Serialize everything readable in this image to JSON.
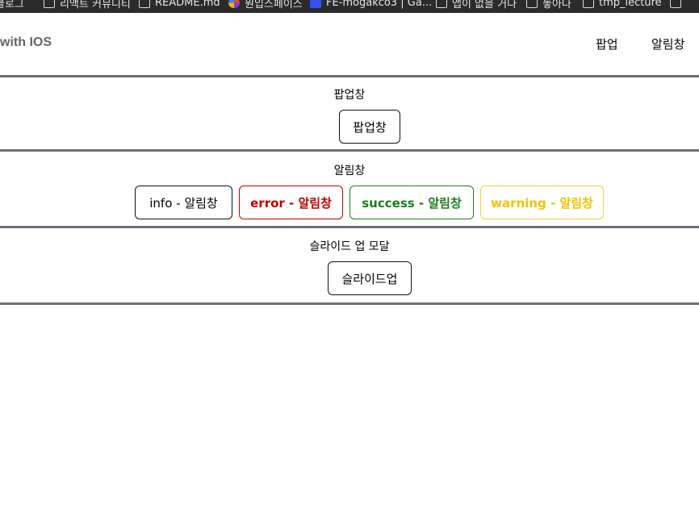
{
  "bookmarks": [
    {
      "label": "블로그",
      "icon": "folder-icon"
    },
    {
      "label": "리액트 커뮤니티",
      "icon": "folder-icon"
    },
    {
      "label": "README.md",
      "icon": "folder-icon"
    },
    {
      "label": "원입스페이스",
      "icon": "globe-icon"
    },
    {
      "label": "FE-mogakco3 | Ga...",
      "icon": "app-icon"
    },
    {
      "label": "앱이 없을 거다",
      "icon": "folder-icon"
    },
    {
      "label": "놓아다",
      "icon": "folder-icon"
    },
    {
      "label": "tmp_lecture",
      "icon": "folder-icon"
    },
    {
      "label": "",
      "icon": "folder-icon"
    }
  ],
  "header": {
    "brand": "with IOS",
    "nav": [
      "팝업",
      "알림창"
    ]
  },
  "sections": {
    "popup": {
      "title": "팝업창",
      "button": "팝업창"
    },
    "alert": {
      "title": "알림창",
      "buttons": {
        "info": "info - 알림창",
        "error": "error - 알림창",
        "success": "success - 알림창",
        "warning": "warning - 알림창"
      }
    },
    "slideup": {
      "title": "슬라이드 업 모달",
      "button": "슬라이드업"
    }
  },
  "colors": {
    "divider": "#6a6f78",
    "error": "#c00000",
    "success": "#1b7d1b",
    "warning": "#f2c200"
  }
}
